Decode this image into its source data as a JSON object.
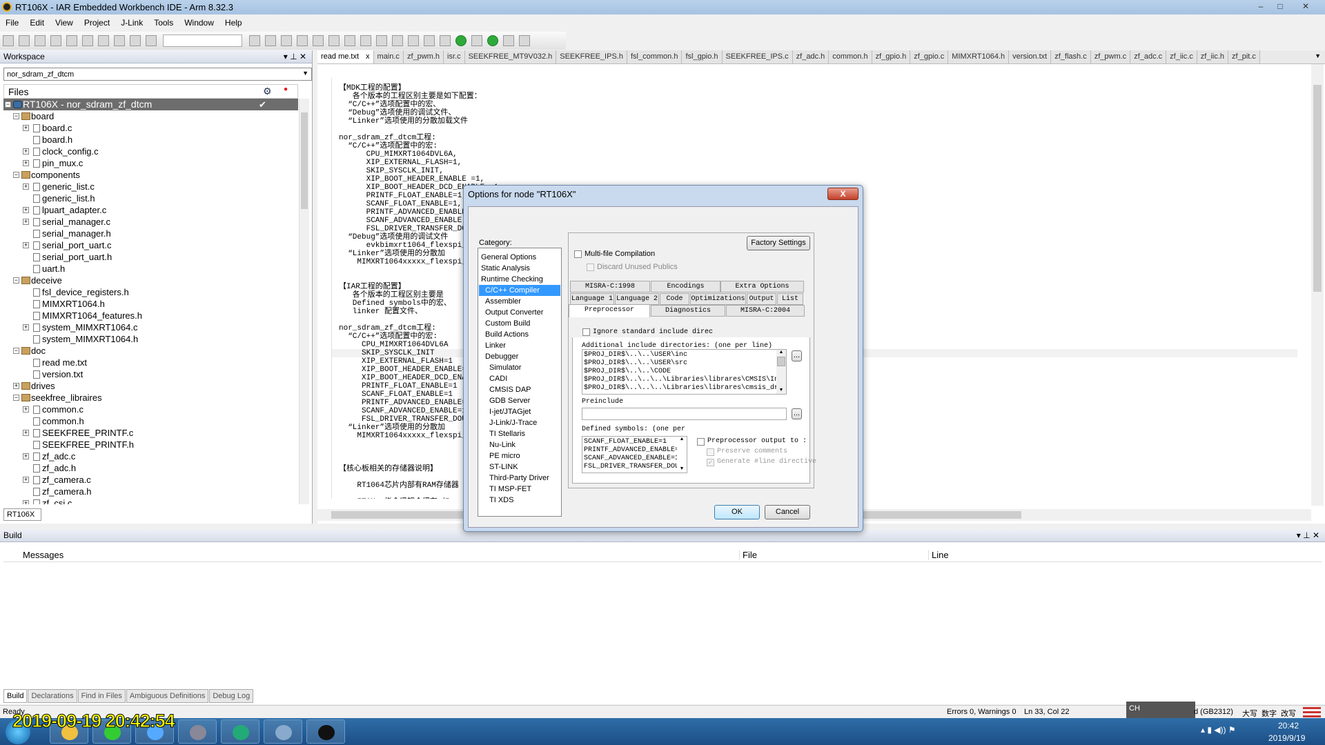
{
  "window": {
    "title": "RT106X - IAR Embedded Workbench IDE - Arm 8.32.3",
    "minimize": "–",
    "maximize": "□",
    "close": "✕"
  },
  "menu": [
    "File",
    "Edit",
    "View",
    "Project",
    "J-Link",
    "Tools",
    "Window",
    "Help"
  ],
  "toolbar": [
    "new-file",
    "open-file",
    "save",
    "save-all",
    "print",
    "cut",
    "copy",
    "paste",
    "undo",
    "redo",
    "find-combo",
    "navigate-back",
    "find",
    "navigate-forward",
    "replace",
    "go-to",
    "previous-bookmark",
    "toggle-bookmark",
    "next-bookmark",
    "previous-error",
    "next-error",
    "compile",
    "make",
    "download-and-debug",
    "debug-without-download",
    "breakpoint",
    "run",
    "run-dropdown",
    "configure"
  ],
  "workspace": {
    "title": "Workspace",
    "config": "nor_sdram_zf_dtcm",
    "files_header": "Files",
    "bottom_tab": "RT106X",
    "tree": [
      {
        "l": 0,
        "t": "p",
        "e": "-",
        "n": "RT106X - nor_sdram_zf_dtcm",
        "sel": true,
        "check": "✔"
      },
      {
        "l": 1,
        "t": "d",
        "e": "-",
        "n": "board"
      },
      {
        "l": 2,
        "t": "f",
        "e": "+",
        "n": "board.c"
      },
      {
        "l": 2,
        "t": "f",
        "e": "",
        "n": "board.h"
      },
      {
        "l": 2,
        "t": "f",
        "e": "+",
        "n": "clock_config.c"
      },
      {
        "l": 2,
        "t": "f",
        "e": "+",
        "n": "pin_mux.c"
      },
      {
        "l": 1,
        "t": "d",
        "e": "-",
        "n": "components"
      },
      {
        "l": 2,
        "t": "f",
        "e": "+",
        "n": "generic_list.c"
      },
      {
        "l": 2,
        "t": "f",
        "e": "",
        "n": "generic_list.h"
      },
      {
        "l": 2,
        "t": "f",
        "e": "+",
        "n": "lpuart_adapter.c"
      },
      {
        "l": 2,
        "t": "f",
        "e": "+",
        "n": "serial_manager.c"
      },
      {
        "l": 2,
        "t": "f",
        "e": "",
        "n": "serial_manager.h"
      },
      {
        "l": 2,
        "t": "f",
        "e": "+",
        "n": "serial_port_uart.c"
      },
      {
        "l": 2,
        "t": "f",
        "e": "",
        "n": "serial_port_uart.h"
      },
      {
        "l": 2,
        "t": "f",
        "e": "",
        "n": "uart.h"
      },
      {
        "l": 1,
        "t": "d",
        "e": "-",
        "n": "deceive"
      },
      {
        "l": 2,
        "t": "f",
        "e": "",
        "n": "fsl_device_registers.h"
      },
      {
        "l": 2,
        "t": "f",
        "e": "",
        "n": "MIMXRT1064.h"
      },
      {
        "l": 2,
        "t": "f",
        "e": "",
        "n": "MIMXRT1064_features.h"
      },
      {
        "l": 2,
        "t": "f",
        "e": "+",
        "n": "system_MIMXRT1064.c"
      },
      {
        "l": 2,
        "t": "f",
        "e": "",
        "n": "system_MIMXRT1064.h"
      },
      {
        "l": 1,
        "t": "d",
        "e": "-",
        "n": "doc"
      },
      {
        "l": 2,
        "t": "f",
        "e": "",
        "n": "read me.txt"
      },
      {
        "l": 2,
        "t": "f",
        "e": "",
        "n": "version.txt"
      },
      {
        "l": 1,
        "t": "d",
        "e": "+",
        "n": "drives"
      },
      {
        "l": 1,
        "t": "d",
        "e": "-",
        "n": "seekfree_libraires"
      },
      {
        "l": 2,
        "t": "f",
        "e": "+",
        "n": "common.c"
      },
      {
        "l": 2,
        "t": "f",
        "e": "",
        "n": "common.h"
      },
      {
        "l": 2,
        "t": "f",
        "e": "+",
        "n": "SEEKFREE_PRINTF.c"
      },
      {
        "l": 2,
        "t": "f",
        "e": "",
        "n": "SEEKFREE_PRINTF.h"
      },
      {
        "l": 2,
        "t": "f",
        "e": "+",
        "n": "zf_adc.c"
      },
      {
        "l": 2,
        "t": "f",
        "e": "",
        "n": "zf_adc.h"
      },
      {
        "l": 2,
        "t": "f",
        "e": "+",
        "n": "zf_camera.c"
      },
      {
        "l": 2,
        "t": "f",
        "e": "",
        "n": "zf_camera.h"
      },
      {
        "l": 2,
        "t": "f",
        "e": "+",
        "n": "zf_csi.c"
      }
    ]
  },
  "editor": {
    "tabs": [
      "read me.txt",
      "main.c",
      "zf_pwm.h",
      "isr.c",
      "SEEKFREE_MT9V032.h",
      "SEEKFREE_IPS.h",
      "fsl_common.h",
      "fsl_gpio.h",
      "SEEKFREE_IPS.c",
      "zf_adc.h",
      "common.h",
      "zf_gpio.h",
      "zf_gpio.c",
      "MIMXRT1064.h",
      "version.txt",
      "zf_flash.c",
      "zf_pwm.c",
      "zf_adc.c",
      "zf_iic.c",
      "zf_iic.h",
      "zf_pit.c"
    ],
    "active_tab_close": "x",
    "current_line": 32,
    "lines": [
      "【MDK工程的配置】",
      "   各个版本的工程区别主要是如下配置：",
      "  “C/C++”选项配置中的宏、",
      "  “Debug”选项使用的调试文件、",
      "  “Linker”选项使用的分散加载文件",
      "",
      "nor_sdram_zf_dtcm工程:",
      "  “C/C++”选项配置中的宏:",
      "      CPU_MIMXRT1064DVL6A,",
      "      XIP_EXTERNAL_FLASH=1,",
      "      SKIP_SYSCLK_INIT,",
      "      XIP_BOOT_HEADER_ENABLE =1,",
      "      XIP_BOOT_HEADER_DCD_ENABLE =1,",
      "      PRINTF_FLOAT_ENABLE=1,",
      "      SCANF_FLOAT_ENABLE=1,",
      "      PRINTF_ADVANCED_ENABLE",
      "      SCANF_ADVANCED_ENABLE",
      "      FSL_DRIVER_TRANSFER_DO",
      "  “Debug”选项使用的调试文件",
      "      evkbimxrt1064_flexspi_",
      "  “Linker”选项使用的分散加",
      "    MIMXRT1064xxxxx_flexspi_",
      "",
      "",
      "【IAR工程的配置】",
      "   各个版本的工程区别主要是",
      "   Defined symbols中的宏、",
      "   linker 配置文件、",
      "",
      "nor_sdram_zf_dtcm工程:",
      "  “C/C++”选项配置中的宏:",
      "     CPU_MIMXRT1064DVL6A",
      "     SKIP_SYSCLK_INIT",
      "     XIP_EXTERNAL_FLASH=1",
      "     XIP_BOOT_HEADER_ENABLE=",
      "     XIP_BOOT_HEADER_DCD_ENA",
      "     PRINTF_FLOAT_ENABLE=1",
      "     SCANF_FLOAT_ENABLE=1",
      "     PRINTF_ADVANCED_ENABLE=",
      "     SCANF_ADVANCED_ENABLE=1",
      "     FSL_DRIVER_TRANSFER_DOU",
      "  “Linker”选项使用的分散加",
      "    MIMXRT1064xxxxx_flexspi_",
      "",
      "",
      "",
      "【核心板相关的存储器说明】",
      "",
      "    RT1064芯片内部有RAM存储器",
      "",
      "    ITCM: 指令紧耦合缓存（In",
      "       默认大小为128KB。总"
    ]
  },
  "build": {
    "title": "Build",
    "columns": [
      "Messages",
      "File",
      "Line"
    ],
    "tabs": [
      "Build",
      "Declarations",
      "Find in Files",
      "Ambiguous Definitions",
      "Debug Log"
    ]
  },
  "status": {
    "ready": "Ready",
    "errors": "Errors 0, Warnings 0",
    "position": "Ln 33, Col 22",
    "encoding": "d (GB2312)",
    "caps": "大写",
    "num": "数字",
    "ovr": "改写",
    "ime": "CH"
  },
  "taskbar": {
    "time": "20:42",
    "date": "2019/9/19",
    "apps": [
      "file-explorer",
      "browser",
      "app-360",
      "computer",
      "iar-app",
      "photos",
      "seekfree-app"
    ]
  },
  "overlay_timestamp": "2019-09-19 20:42:54",
  "dialog": {
    "title": "Options for node \"RT106X\"",
    "close": "X",
    "category_label": "Category:",
    "categories": [
      {
        "n": "General Options",
        "i": 0
      },
      {
        "n": "Static Analysis",
        "i": 0
      },
      {
        "n": "Runtime Checking",
        "i": 0
      },
      {
        "n": "C/C++ Compiler",
        "i": 1,
        "sel": true
      },
      {
        "n": "Assembler",
        "i": 1
      },
      {
        "n": "Output Converter",
        "i": 1
      },
      {
        "n": "Custom Build",
        "i": 1
      },
      {
        "n": "Build Actions",
        "i": 1
      },
      {
        "n": "Linker",
        "i": 1
      },
      {
        "n": "Debugger",
        "i": 1
      },
      {
        "n": "Simulator",
        "i": 2
      },
      {
        "n": "CADI",
        "i": 2
      },
      {
        "n": "CMSIS DAP",
        "i": 2
      },
      {
        "n": "GDB Server",
        "i": 2
      },
      {
        "n": "I-jet/JTAGjet",
        "i": 2
      },
      {
        "n": "J-Link/J-Trace",
        "i": 2
      },
      {
        "n": "TI Stellaris",
        "i": 2
      },
      {
        "n": "Nu-Link",
        "i": 2
      },
      {
        "n": "PE micro",
        "i": 2
      },
      {
        "n": "ST-LINK",
        "i": 2
      },
      {
        "n": "Third-Party Driver",
        "i": 2
      },
      {
        "n": "TI MSP-FET",
        "i": 2
      },
      {
        "n": "TI XDS",
        "i": 2
      }
    ],
    "factory_settings": "Factory Settings",
    "multi_file": {
      "label": "Multi-file Compilation",
      "checked": false
    },
    "discard_unused": {
      "label": "Discard Unused Publics",
      "checked": false,
      "disabled": true
    },
    "tabs_row1": [
      "MISRA-C:1998",
      "Encodings",
      "Extra Options"
    ],
    "tabs_row2": [
      "Language 1",
      "Language 2",
      "Code",
      "Optimizations",
      "Output",
      "List"
    ],
    "tabs_row3": [
      "Preprocessor",
      "Diagnostics",
      "MISRA-C:2004"
    ],
    "active_tab": "Preprocessor",
    "ignore_std": {
      "label": "Ignore standard include direc",
      "checked": false
    },
    "include_label": "Additional include directories: (one per line)",
    "include_dirs": [
      "$PROJ_DIR$\\..\\..\\USER\\inc",
      "$PROJ_DIR$\\..\\..\\USER\\src",
      "$PROJ_DIR$\\..\\..\\CODE",
      "$PROJ_DIR$\\..\\..\\..\\Libraries\\librares\\CMSIS\\Includ",
      "$PROJ_DIR$\\..\\..\\..\\Libraries\\librares\\cmsis_driver"
    ],
    "browse": "...",
    "preinclude_label": "Preinclude",
    "preinclude_value": "",
    "defined_label": "Defined symbols: (one per",
    "defined_symbols": [
      "SCANF_FLOAT_ENABLE=1",
      "PRINTF_ADVANCED_ENABLE=1",
      "SCANF_ADVANCED_ENABLE=1",
      "FSL_DRIVER_TRANSFER_DOUBI"
    ],
    "pp_output": {
      "label": "Preprocessor output to :",
      "checked": false
    },
    "preserve_comments": {
      "label": "Preserve comments",
      "checked": false,
      "disabled": true
    },
    "generate_line": {
      "label": "Generate #line directive",
      "checked": true,
      "disabled": true
    },
    "ok": "OK",
    "cancel": "Cancel"
  }
}
